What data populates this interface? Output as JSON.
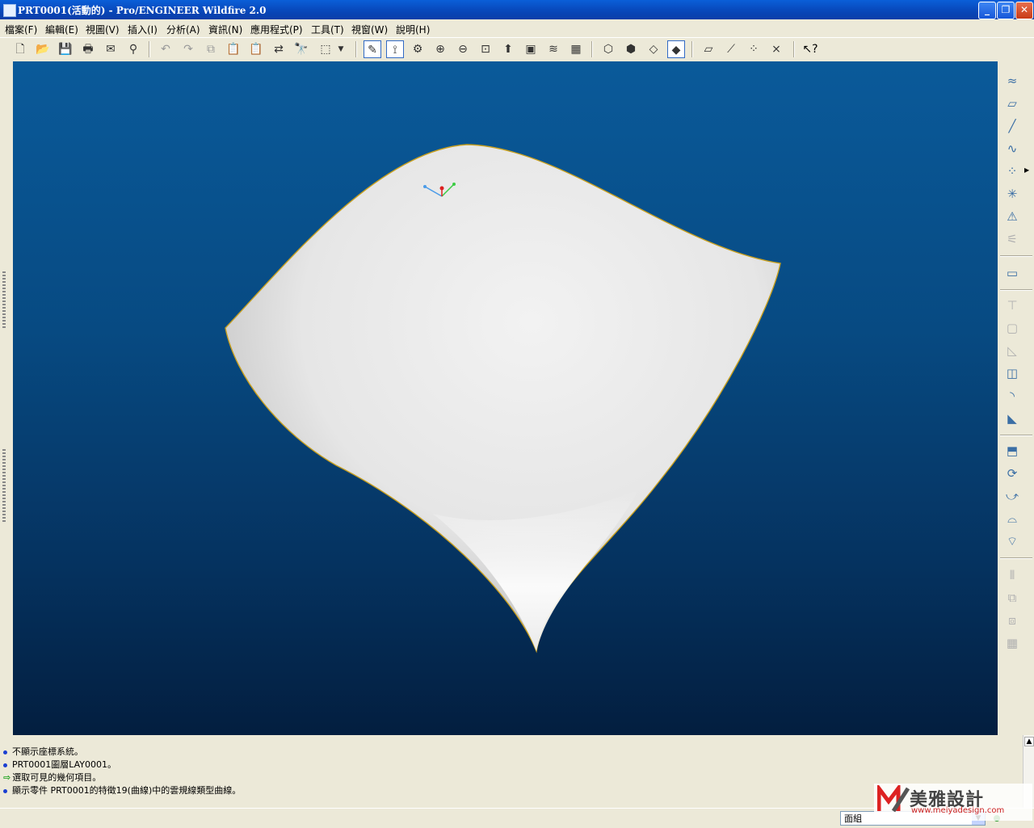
{
  "window": {
    "title": "PRT0001(活動的) - Pro/ENGINEER Wildfire 2.0",
    "controls": [
      "_",
      "❐",
      "✕"
    ]
  },
  "menu": [
    "檔案(F)",
    "編輯(E)",
    "視圖(V)",
    "插入(I)",
    "分析(A)",
    "資訊(N)",
    "應用程式(P)",
    "工具(T)",
    "視窗(W)",
    "說明(H)"
  ],
  "messages": [
    {
      "type": "info",
      "text": "不顯示座標系統。"
    },
    {
      "type": "info",
      "text": "PRT0001圖層LAY0001。"
    },
    {
      "type": "prompt",
      "text": "選取可見的幾何項目。"
    },
    {
      "type": "info",
      "text": "顯示零件 PRT0001的特徵19(曲線)中的雲規線類型曲線。"
    }
  ],
  "statusbar": {
    "filter_value": "面組"
  },
  "watermark": {
    "title": "美雅設計",
    "url": "www.meiyadesign.com"
  },
  "colors": {
    "viewport_top": "#0a5a9a",
    "viewport_bottom": "#031e3f",
    "surface_edge": "#c8a020",
    "titlebar": "#0846b8"
  }
}
